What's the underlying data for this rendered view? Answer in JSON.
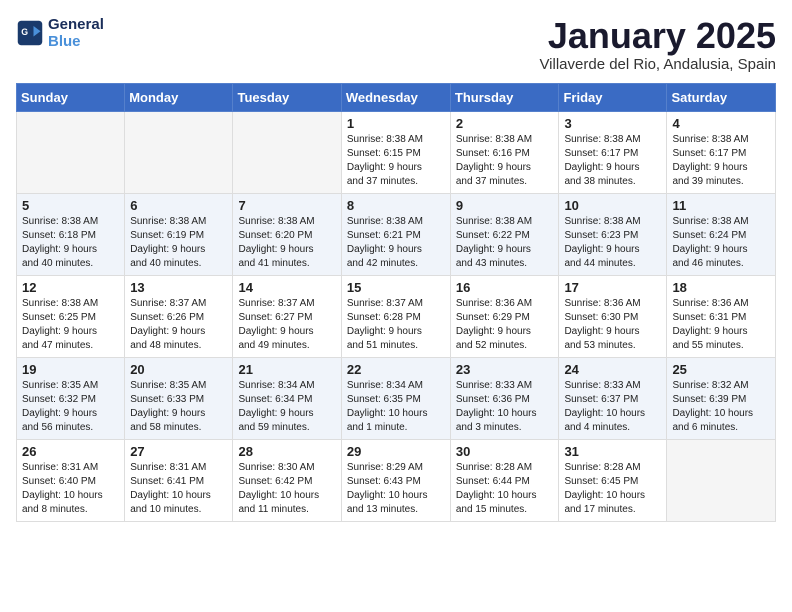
{
  "logo": {
    "line1": "General",
    "line2": "Blue"
  },
  "title": "January 2025",
  "location": "Villaverde del Rio, Andalusia, Spain",
  "weekdays": [
    "Sunday",
    "Monday",
    "Tuesday",
    "Wednesday",
    "Thursday",
    "Friday",
    "Saturday"
  ],
  "weeks": [
    [
      {
        "day": "",
        "info": ""
      },
      {
        "day": "",
        "info": ""
      },
      {
        "day": "",
        "info": ""
      },
      {
        "day": "1",
        "info": "Sunrise: 8:38 AM\nSunset: 6:15 PM\nDaylight: 9 hours\nand 37 minutes."
      },
      {
        "day": "2",
        "info": "Sunrise: 8:38 AM\nSunset: 6:16 PM\nDaylight: 9 hours\nand 37 minutes."
      },
      {
        "day": "3",
        "info": "Sunrise: 8:38 AM\nSunset: 6:17 PM\nDaylight: 9 hours\nand 38 minutes."
      },
      {
        "day": "4",
        "info": "Sunrise: 8:38 AM\nSunset: 6:17 PM\nDaylight: 9 hours\nand 39 minutes."
      }
    ],
    [
      {
        "day": "5",
        "info": "Sunrise: 8:38 AM\nSunset: 6:18 PM\nDaylight: 9 hours\nand 40 minutes."
      },
      {
        "day": "6",
        "info": "Sunrise: 8:38 AM\nSunset: 6:19 PM\nDaylight: 9 hours\nand 40 minutes."
      },
      {
        "day": "7",
        "info": "Sunrise: 8:38 AM\nSunset: 6:20 PM\nDaylight: 9 hours\nand 41 minutes."
      },
      {
        "day": "8",
        "info": "Sunrise: 8:38 AM\nSunset: 6:21 PM\nDaylight: 9 hours\nand 42 minutes."
      },
      {
        "day": "9",
        "info": "Sunrise: 8:38 AM\nSunset: 6:22 PM\nDaylight: 9 hours\nand 43 minutes."
      },
      {
        "day": "10",
        "info": "Sunrise: 8:38 AM\nSunset: 6:23 PM\nDaylight: 9 hours\nand 44 minutes."
      },
      {
        "day": "11",
        "info": "Sunrise: 8:38 AM\nSunset: 6:24 PM\nDaylight: 9 hours\nand 46 minutes."
      }
    ],
    [
      {
        "day": "12",
        "info": "Sunrise: 8:38 AM\nSunset: 6:25 PM\nDaylight: 9 hours\nand 47 minutes."
      },
      {
        "day": "13",
        "info": "Sunrise: 8:37 AM\nSunset: 6:26 PM\nDaylight: 9 hours\nand 48 minutes."
      },
      {
        "day": "14",
        "info": "Sunrise: 8:37 AM\nSunset: 6:27 PM\nDaylight: 9 hours\nand 49 minutes."
      },
      {
        "day": "15",
        "info": "Sunrise: 8:37 AM\nSunset: 6:28 PM\nDaylight: 9 hours\nand 51 minutes."
      },
      {
        "day": "16",
        "info": "Sunrise: 8:36 AM\nSunset: 6:29 PM\nDaylight: 9 hours\nand 52 minutes."
      },
      {
        "day": "17",
        "info": "Sunrise: 8:36 AM\nSunset: 6:30 PM\nDaylight: 9 hours\nand 53 minutes."
      },
      {
        "day": "18",
        "info": "Sunrise: 8:36 AM\nSunset: 6:31 PM\nDaylight: 9 hours\nand 55 minutes."
      }
    ],
    [
      {
        "day": "19",
        "info": "Sunrise: 8:35 AM\nSunset: 6:32 PM\nDaylight: 9 hours\nand 56 minutes."
      },
      {
        "day": "20",
        "info": "Sunrise: 8:35 AM\nSunset: 6:33 PM\nDaylight: 9 hours\nand 58 minutes."
      },
      {
        "day": "21",
        "info": "Sunrise: 8:34 AM\nSunset: 6:34 PM\nDaylight: 9 hours\nand 59 minutes."
      },
      {
        "day": "22",
        "info": "Sunrise: 8:34 AM\nSunset: 6:35 PM\nDaylight: 10 hours\nand 1 minute."
      },
      {
        "day": "23",
        "info": "Sunrise: 8:33 AM\nSunset: 6:36 PM\nDaylight: 10 hours\nand 3 minutes."
      },
      {
        "day": "24",
        "info": "Sunrise: 8:33 AM\nSunset: 6:37 PM\nDaylight: 10 hours\nand 4 minutes."
      },
      {
        "day": "25",
        "info": "Sunrise: 8:32 AM\nSunset: 6:39 PM\nDaylight: 10 hours\nand 6 minutes."
      }
    ],
    [
      {
        "day": "26",
        "info": "Sunrise: 8:31 AM\nSunset: 6:40 PM\nDaylight: 10 hours\nand 8 minutes."
      },
      {
        "day": "27",
        "info": "Sunrise: 8:31 AM\nSunset: 6:41 PM\nDaylight: 10 hours\nand 10 minutes."
      },
      {
        "day": "28",
        "info": "Sunrise: 8:30 AM\nSunset: 6:42 PM\nDaylight: 10 hours\nand 11 minutes."
      },
      {
        "day": "29",
        "info": "Sunrise: 8:29 AM\nSunset: 6:43 PM\nDaylight: 10 hours\nand 13 minutes."
      },
      {
        "day": "30",
        "info": "Sunrise: 8:28 AM\nSunset: 6:44 PM\nDaylight: 10 hours\nand 15 minutes."
      },
      {
        "day": "31",
        "info": "Sunrise: 8:28 AM\nSunset: 6:45 PM\nDaylight: 10 hours\nand 17 minutes."
      },
      {
        "day": "",
        "info": ""
      }
    ]
  ]
}
